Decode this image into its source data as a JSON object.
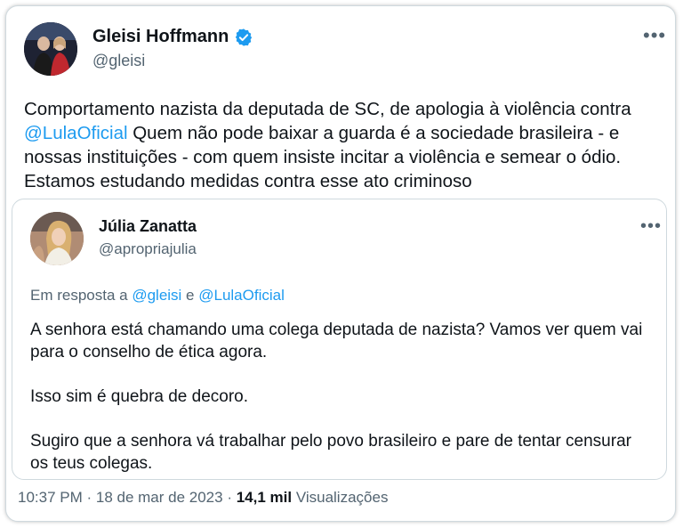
{
  "author": {
    "name": "Gleisi Hoffmann",
    "handle": "@gleisi",
    "verified_icon": "verified-badge-icon",
    "verified_color": "#1d9bf0"
  },
  "tweet": {
    "text_before": "Comportamento nazista da deputada de SC, de apologia à violência contra ",
    "mention": "@LulaOficial",
    "text_after": " Quem não pode baixar a guarda é a sociedade brasileira - e nossas instituições - com quem insiste incitar a violência e semear o ódio. Estamos estudando medidas contra esse ato criminoso"
  },
  "more_icon": "more-options-icon",
  "quoted": {
    "name": "Júlia Zanatta",
    "handle": "@apropriajulia",
    "replying_prefix": "Em resposta a ",
    "replying_user1": "@gleisi",
    "replying_joiner": " e ",
    "replying_user2": "@LulaOficial",
    "paragraphs": [
      "A senhora está chamando uma colega deputada de nazista? Vamos ver quem vai para o conselho de ética agora.",
      "Isso sim é quebra de decoro.",
      "Sugiro que a senhora vá trabalhar pelo povo brasileiro e pare de tentar censurar os teus colegas."
    ]
  },
  "footer": {
    "time": "10:37 PM",
    "separator": " · ",
    "date": "18 de mar de 2023",
    "views_count": "14,1 mil",
    "views_label": "Visualizações"
  },
  "colors": {
    "link": "#1d9bf0",
    "secondary_text": "#536471",
    "primary_text": "#0f1419",
    "border": "#cfd9de"
  }
}
